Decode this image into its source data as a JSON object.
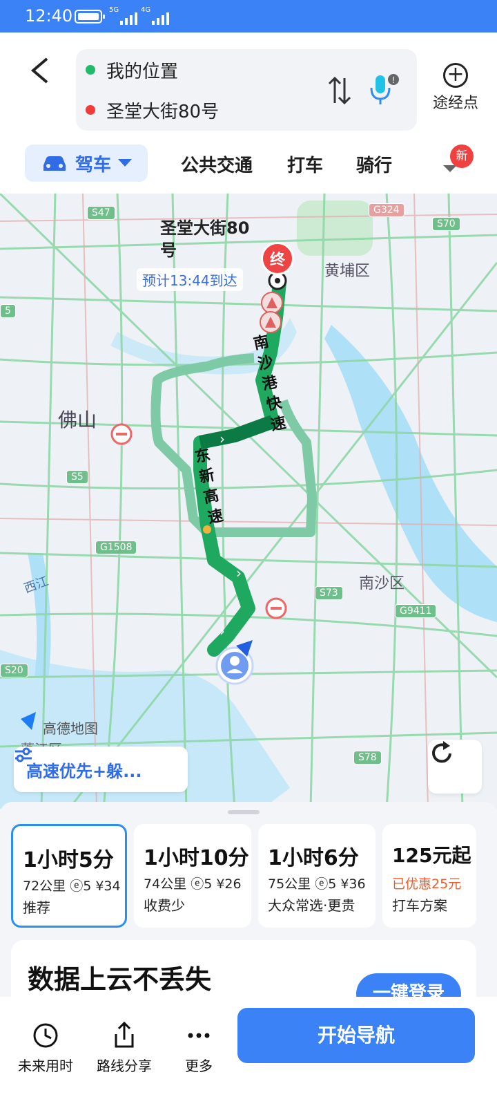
{
  "status_bar": {
    "time": "12:40",
    "net_a": "5G",
    "net_b": "4G"
  },
  "search": {
    "origin": "我的位置",
    "destination": "圣堂大街80号",
    "waypoint_label": "途经点"
  },
  "modes": {
    "drive": "驾车",
    "transit": "公共交通",
    "taxi": "打车",
    "ride": "骑行",
    "new_badge": "新"
  },
  "map": {
    "dest_label_line1": "圣堂大街80",
    "dest_label_line2": "号",
    "end_marker": "终",
    "eta": "预计13:44到达",
    "districts": [
      "黄埔区",
      "佛山",
      "南沙区",
      "西江"
    ],
    "road_names": {
      "nansha": "南沙港快速",
      "dongxin": "东新高速"
    },
    "shields": [
      "S47",
      "G324",
      "S70",
      "S5",
      "G1508",
      "S73",
      "G9411",
      "S20",
      "S78",
      "5"
    ],
    "logo": "高德地图",
    "partial_district": "蓬江区",
    "route_preference": "高速优先+躲..."
  },
  "routes": [
    {
      "time": "1小时5分",
      "detail": "72公里 ⓔ5 ¥34",
      "sub": "推荐",
      "selected": true
    },
    {
      "time": "1小时10分",
      "detail": "74公里 ⓔ5 ¥26",
      "sub": "收费少",
      "selected": false
    },
    {
      "time": "1小时6分",
      "detail": "75公里 ⓔ5 ¥36",
      "sub": "大众常选·更贵",
      "selected": false
    },
    {
      "time": "125元起",
      "detail": "已优惠25元",
      "sub": "打车方案",
      "selected": false
    }
  ],
  "promo": {
    "title": "数据上云不丢失",
    "login": "一键登录"
  },
  "bottom": {
    "future": "未来用时",
    "share": "路线分享",
    "more": "更多",
    "start": "开始导航"
  },
  "colors": {
    "brand": "#3b82f6",
    "origin_dot": "#1fba6a",
    "dest_dot": "#ef3b3b",
    "route_main": "#1fa85f",
    "route_alt": "#7fcaa6"
  }
}
